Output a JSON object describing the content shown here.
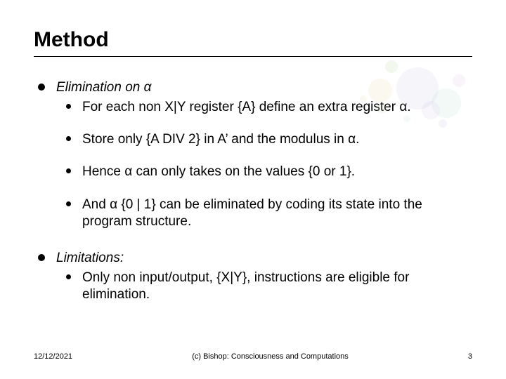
{
  "title": "Method",
  "sections": [
    {
      "heading_prefix": "Elimination on ",
      "heading_var": "α",
      "items": [
        "For each non X|Y register {A} define an extra register α.",
        "Store only {A DIV 2} in A’ and the modulus in α.",
        "Hence α can only takes on the values {0 or 1}.",
        "And α {0 | 1} can be eliminated by coding its state into the program structure."
      ]
    },
    {
      "heading_prefix": "Limitations:",
      "heading_var": "",
      "items": [
        "Only non input/output, {X|Y}, instructions are eligible for elimination."
      ]
    }
  ],
  "footer": {
    "date": "12/12/2021",
    "center": "(c) Bishop: Consciousness and Computations",
    "page": "3"
  }
}
